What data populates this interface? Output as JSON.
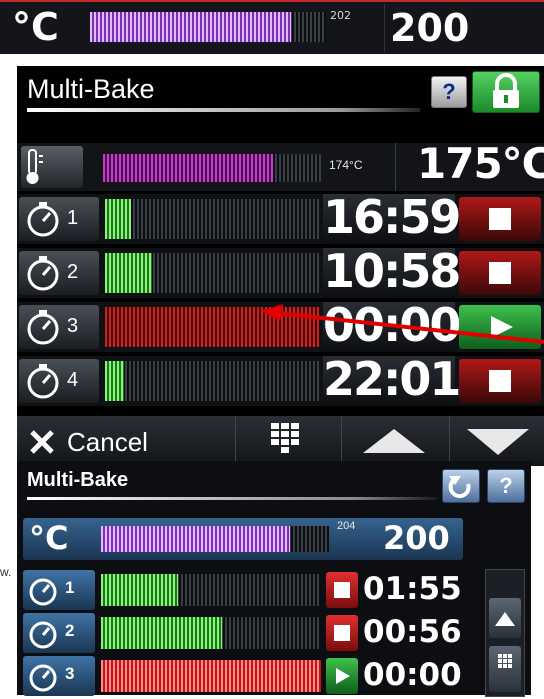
{
  "top_strip": {
    "unit": "°C",
    "current_temp": "202",
    "set_temp": "200",
    "bar_fill": 0.85
  },
  "main": {
    "title": "Multi-Bake",
    "help_label": "?",
    "lock_icon": "lock-icon",
    "temperature": {
      "icon": "thermometer-icon",
      "current": "174°C",
      "set": "175°C",
      "bar_fill": 0.78
    },
    "timers": [
      {
        "index": "1",
        "time": "16:59",
        "state": "running",
        "bar_fill": 0.12,
        "action_icon": "stop-icon",
        "action_color": "#b01818"
      },
      {
        "index": "2",
        "time": "10:58",
        "state": "running",
        "bar_fill": 0.22,
        "action_icon": "stop-icon",
        "action_color": "#b01818"
      },
      {
        "index": "3",
        "time": "00:00",
        "state": "done",
        "bar_fill": 1.0,
        "action_icon": "play-icon",
        "action_color": "#1f9a2e"
      },
      {
        "index": "4",
        "time": "22:01",
        "state": "running",
        "bar_fill": 0.09,
        "action_icon": "stop-icon",
        "action_color": "#b01818"
      }
    ],
    "toolbar": {
      "cancel_label": "Cancel",
      "keypad_icon": "keypad-icon",
      "up_icon": "arrow-up-icon",
      "down_icon": "arrow-down-icon"
    }
  },
  "lower": {
    "title": "Multi-Bake",
    "refresh_icon": "refresh-icon",
    "help_label": "?",
    "unit": "°C",
    "current_temp": "204",
    "set_temp": "200",
    "bar_fill": 0.83,
    "timers": [
      {
        "index": "1",
        "time": "01:55",
        "bar_fill": 0.35
      },
      {
        "index": "2",
        "time": "00:56",
        "bar_fill": 0.55
      },
      {
        "index": "3",
        "time": "00:00",
        "bar_fill": 1.0
      }
    ],
    "side_text": "w."
  },
  "colors": {
    "accent_red": "#c8282a",
    "ok_green": "#1f9a2e",
    "stop_red": "#b01818",
    "bar_purple": "#7c2fb5",
    "bar_green": "#167a1a"
  }
}
